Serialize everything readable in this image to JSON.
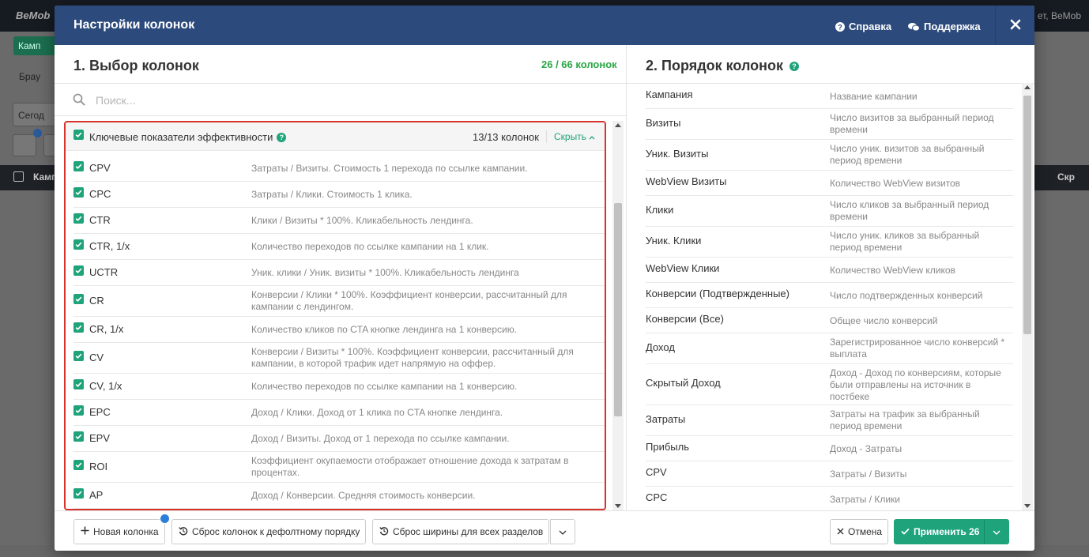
{
  "background": {
    "logo": "BeMob",
    "user": "ет, BeMob",
    "campaign_btn": "Камп",
    "browser": "Брау",
    "date_btn": "Сегод",
    "table_first_col": "Камп",
    "table_last_col": "Скр"
  },
  "modal": {
    "title": "Настройки колонок",
    "help_label": "Справка",
    "support_label": "Поддержка"
  },
  "left": {
    "title": "1. Выбор колонок",
    "count": "26 / 66 колонок",
    "search_placeholder": "Поиск...",
    "group": {
      "title": "Ключевые показатели эффективности",
      "count": "13/13 колонок",
      "hide_label": "Скрыть"
    },
    "items": [
      {
        "name": "CPV",
        "desc": "Затраты / Визиты. Стоимость 1 перехода по ссылке кампании."
      },
      {
        "name": "CPC",
        "desc": "Затраты / Клики. Стоимость 1 клика."
      },
      {
        "name": "CTR",
        "desc": "Клики / Визиты * 100%. Кликабельность лендинга."
      },
      {
        "name": "CTR, 1/x",
        "desc": "Количество переходов по ссылке кампании на 1 клик."
      },
      {
        "name": "UCTR",
        "desc": "Уник. клики / Уник. визиты * 100%. Кликабельность лендинга"
      },
      {
        "name": "CR",
        "desc": "Конверсии / Клики * 100%. Коэффициент конверсии, рассчитанный для кампании с лендингом."
      },
      {
        "name": "CR, 1/x",
        "desc": "Количество кликов по CTA кнопке лендинга на 1 конверсию."
      },
      {
        "name": "CV",
        "desc": "Конверсии / Визиты * 100%. Коэффициент конверсии, рассчитанный для кампании, в которой трафик идет напрямую на оффер."
      },
      {
        "name": "CV, 1/x",
        "desc": "Количество переходов по ссылке кампании на 1 конверсию."
      },
      {
        "name": "EPC",
        "desc": "Доход / Клики. Доход от 1 клика по CTA кнопке лендинга."
      },
      {
        "name": "EPV",
        "desc": "Доход / Визиты. Доход от 1 перехода по ссылке кампании."
      },
      {
        "name": "ROI",
        "desc": "Коэффициент окупаемости отображает отношение дохода к затратам в процентах."
      },
      {
        "name": "AP",
        "desc": "Доход / Конверсии. Средняя стоимость конверсии."
      }
    ]
  },
  "right": {
    "title": "2. Порядок колонок",
    "items": [
      {
        "name": "Кампания",
        "desc": "Название кампании"
      },
      {
        "name": "Визиты",
        "desc": "Число визитов за выбранный период времени"
      },
      {
        "name": "Уник. Визиты",
        "desc": "Число уник. визитов за выбранный период времени"
      },
      {
        "name": "WebView Визиты",
        "desc": "Количество WebView визитов"
      },
      {
        "name": "Клики",
        "desc": "Число кликов за выбранный период времени"
      },
      {
        "name": "Уник. Клики",
        "desc": "Число уник. кликов за выбранный период времени"
      },
      {
        "name": "WebView Клики",
        "desc": "Количество WebView кликов"
      },
      {
        "name": "Конверсии (Подтвержденные)",
        "desc": "Число подтвержденных конверсий"
      },
      {
        "name": "Конверсии (Все)",
        "desc": "Общее число конверсий"
      },
      {
        "name": "Доход",
        "desc": "Зарегистрированное число конверсий * выплата"
      },
      {
        "name": "Скрытый Доход",
        "desc": "Доход - Доход по конверсиям, которые были отправлены на источник в постбеке"
      },
      {
        "name": "Затраты",
        "desc": "Затраты на трафик за выбранный период времени"
      },
      {
        "name": "Прибыль",
        "desc": "Доход - Затраты"
      },
      {
        "name": "CPV",
        "desc": "Затраты / Визиты"
      },
      {
        "name": "CPC",
        "desc": "Затраты / Клики"
      }
    ]
  },
  "footer": {
    "new_column": "Новая колонка",
    "reset_order": "Сброс колонок к дефолтному порядку",
    "reset_width": "Сброс ширины для всех разделов",
    "cancel": "Отмена",
    "apply": "Применить 26"
  },
  "colors": {
    "header_bg": "#2c4a7c",
    "accent": "#1fa37a",
    "highlight_border": "#d9342b"
  }
}
